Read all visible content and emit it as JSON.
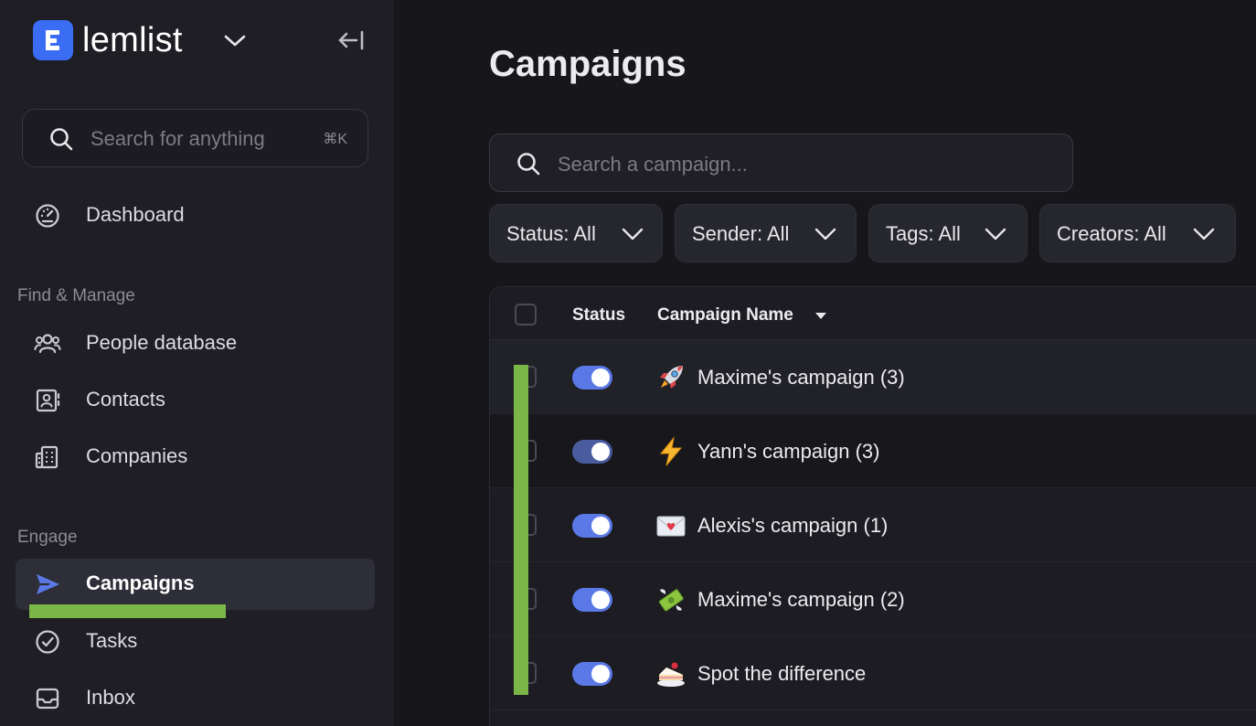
{
  "brand": {
    "name": "lemlist"
  },
  "sidebar": {
    "search_placeholder": "Search for anything",
    "search_shortcut": "⌘K",
    "dashboard": "Dashboard",
    "sections": {
      "find_manage": "Find & Manage",
      "engage": "Engage"
    },
    "items": [
      {
        "label": "People database",
        "icon": "people-icon"
      },
      {
        "label": "Contacts",
        "icon": "contact-card-icon"
      },
      {
        "label": "Companies",
        "icon": "building-icon"
      },
      {
        "label": "Campaigns",
        "icon": "send-icon",
        "active": true
      },
      {
        "label": "Tasks",
        "icon": "check-circle-icon"
      },
      {
        "label": "Inbox",
        "icon": "inbox-icon"
      }
    ]
  },
  "main": {
    "title": "Campaigns",
    "search_placeholder": "Search a campaign...",
    "filters": [
      {
        "label": "Status: All"
      },
      {
        "label": "Sender: All"
      },
      {
        "label": "Tags: All"
      },
      {
        "label": "Creators: All"
      }
    ],
    "table": {
      "columns": [
        "Status",
        "Campaign Name"
      ],
      "rows": [
        {
          "emoji": "rocket-icon",
          "name": "Maxime's campaign (3)",
          "enabled": true
        },
        {
          "emoji": "lightning-icon",
          "name": "Yann's campaign (3)",
          "enabled": true
        },
        {
          "emoji": "love-letter-icon",
          "name": "Alexis's campaign (1)",
          "enabled": true
        },
        {
          "emoji": "money-wings-icon",
          "name": "Maxime's campaign (2)",
          "enabled": true
        },
        {
          "emoji": "cake-icon",
          "name": "Spot the difference",
          "enabled": true
        }
      ]
    }
  },
  "colors": {
    "accent": "#3a6cf4",
    "toggle_on": "#5a79e6",
    "highlight_green": "#7ab648",
    "sidebar_bg": "#1e1e24",
    "main_bg": "#16161b"
  }
}
